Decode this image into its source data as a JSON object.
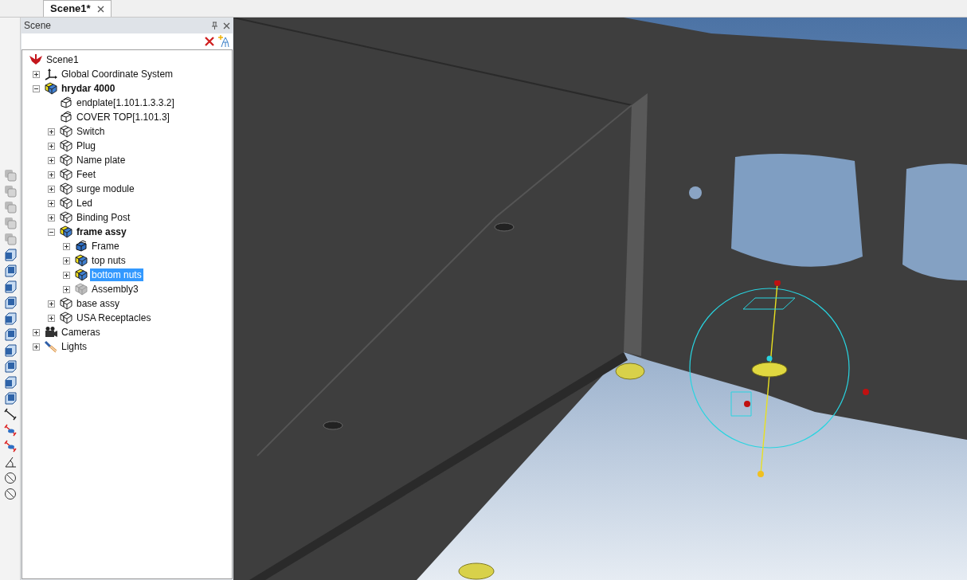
{
  "document_tabs": [
    {
      "label": "Scene1*",
      "selected": true
    }
  ],
  "scene_panel": {
    "title": "Scene",
    "tree": [
      {
        "label": "Scene1",
        "kind": "scene",
        "active": false,
        "selected": false,
        "children": [
          {
            "label": "Global Coordinate System",
            "kind": "axes",
            "active": false,
            "selected": false,
            "expanded": false
          },
          {
            "label": "hrydar 4000",
            "kind": "assembly-active",
            "active": true,
            "selected": false,
            "expanded": true,
            "children": [
              {
                "label": "endplate[1.101.1.3.3.2]",
                "kind": "part",
                "active": false,
                "selected": false
              },
              {
                "label": "COVER TOP[1.101.3]",
                "kind": "part",
                "active": false,
                "selected": false
              },
              {
                "label": "Switch",
                "kind": "assembly",
                "active": false,
                "selected": false,
                "expanded": false
              },
              {
                "label": "Plug",
                "kind": "assembly",
                "active": false,
                "selected": false,
                "expanded": false
              },
              {
                "label": "Name plate",
                "kind": "assembly",
                "active": false,
                "selected": false,
                "expanded": false
              },
              {
                "label": "Feet",
                "kind": "assembly",
                "active": false,
                "selected": false,
                "expanded": false
              },
              {
                "label": "surge module",
                "kind": "assembly",
                "active": false,
                "selected": false,
                "expanded": false
              },
              {
                "label": "Led",
                "kind": "assembly",
                "active": false,
                "selected": false,
                "expanded": false
              },
              {
                "label": "Binding Post",
                "kind": "assembly",
                "active": false,
                "selected": false,
                "expanded": false
              },
              {
                "label": "frame assy",
                "kind": "assembly-active",
                "active": true,
                "selected": false,
                "expanded": true,
                "children": [
                  {
                    "label": "Frame",
                    "kind": "part-solid",
                    "active": false,
                    "selected": false,
                    "expanded": false
                  },
                  {
                    "label": "top nuts",
                    "kind": "assembly-active",
                    "active": false,
                    "selected": false,
                    "expanded": false
                  },
                  {
                    "label": "bottom nuts",
                    "kind": "assembly-active",
                    "active": false,
                    "selected": true,
                    "expanded": false
                  },
                  {
                    "label": "Assembly3",
                    "kind": "assembly-hidden",
                    "active": false,
                    "selected": false,
                    "expanded": false
                  }
                ]
              },
              {
                "label": "base assy",
                "kind": "assembly",
                "active": false,
                "selected": false,
                "expanded": false
              },
              {
                "label": "USA Receptacles",
                "kind": "assembly",
                "active": false,
                "selected": false,
                "expanded": false
              }
            ]
          },
          {
            "label": "Cameras",
            "kind": "camera",
            "active": false,
            "selected": false,
            "expanded": false
          },
          {
            "label": "Lights",
            "kind": "light",
            "active": false,
            "selected": false,
            "expanded": false
          }
        ]
      }
    ]
  }
}
